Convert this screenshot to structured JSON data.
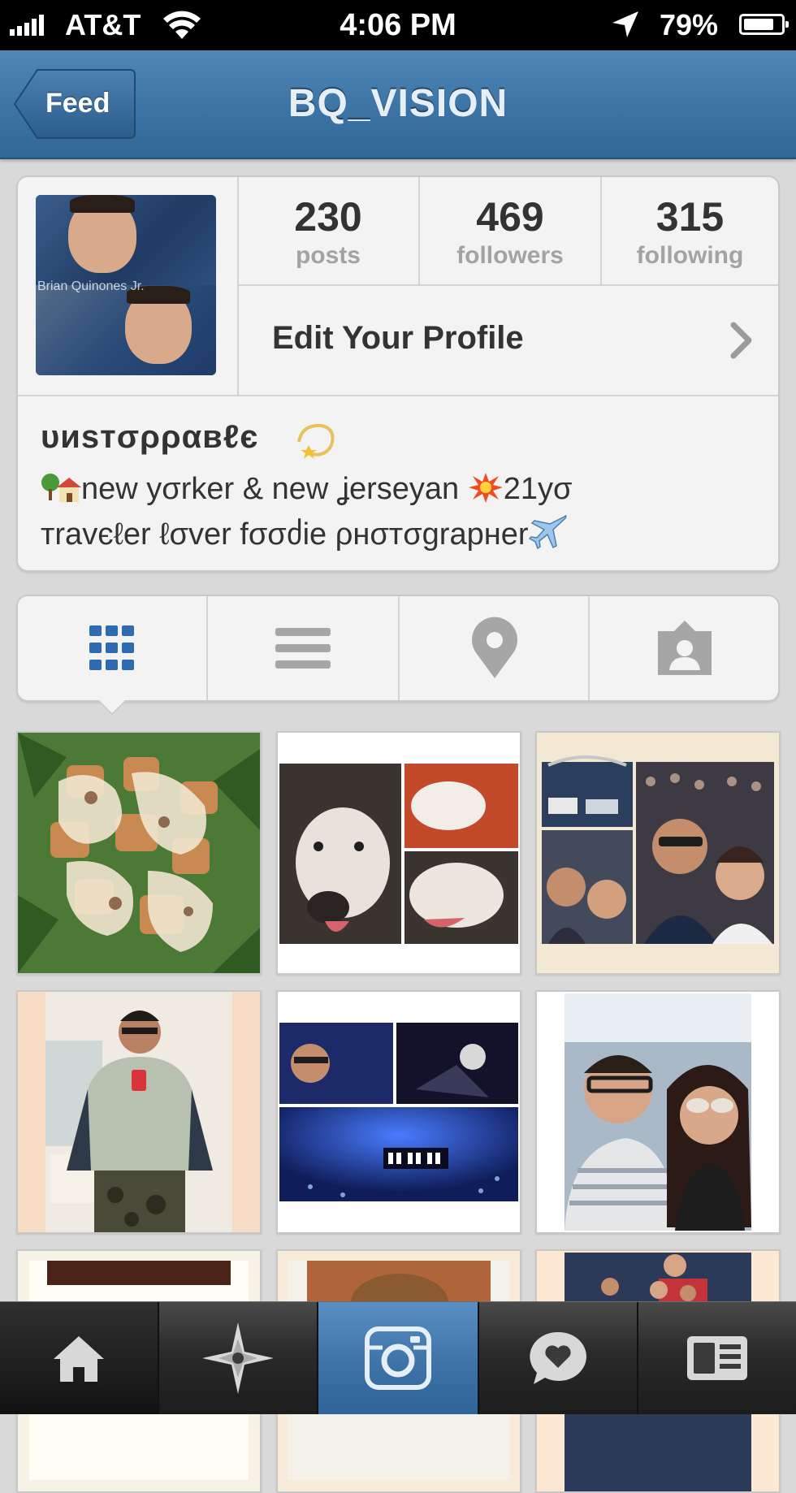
{
  "status_bar": {
    "carrier": "AT&T",
    "time": "4:06 PM",
    "battery": "79%"
  },
  "nav": {
    "back_label": "Feed",
    "title": "BQ_VISION"
  },
  "profile": {
    "avatar_caption": "Brian Quinones Jr.",
    "stats": [
      {
        "value": "230",
        "label": "posts"
      },
      {
        "value": "469",
        "label": "followers"
      },
      {
        "value": "315",
        "label": "following"
      }
    ],
    "edit_label": "Edit Your Profile",
    "bio_name": "υиѕтσρραвℓє",
    "bio_line1": "new yσrker & new ʝerseyan",
    "bio_line1_suffix": "21yσ",
    "bio_line2": "тravєℓer ℓσver fσσძie ρнσтσgrapнer"
  },
  "view_tabs": [
    {
      "icon": "grid-icon",
      "active": true
    },
    {
      "icon": "list-icon",
      "active": false
    },
    {
      "icon": "map-pin-icon",
      "active": false
    },
    {
      "icon": "tagged-person-icon",
      "active": false
    }
  ],
  "photos": [
    {
      "subject": "salad"
    },
    {
      "subject": "dog-collage"
    },
    {
      "subject": "street-festival-collage"
    },
    {
      "subject": "mirror-selfie"
    },
    {
      "subject": "concert-collage"
    },
    {
      "subject": "couple-selfie"
    },
    {
      "subject": "partial-photo"
    },
    {
      "subject": "partial-photo"
    },
    {
      "subject": "partial-group-photo"
    }
  ],
  "tab_bar": [
    {
      "icon": "home-icon"
    },
    {
      "icon": "explore-star-icon"
    },
    {
      "icon": "camera-icon"
    },
    {
      "icon": "heart-bubble-icon"
    },
    {
      "icon": "profile-card-icon"
    }
  ],
  "colors": {
    "nav_blue": "#3d74a6",
    "active_tab_blue": "#2e6bb0",
    "inactive_icon_gray": "#a6a6a6"
  }
}
